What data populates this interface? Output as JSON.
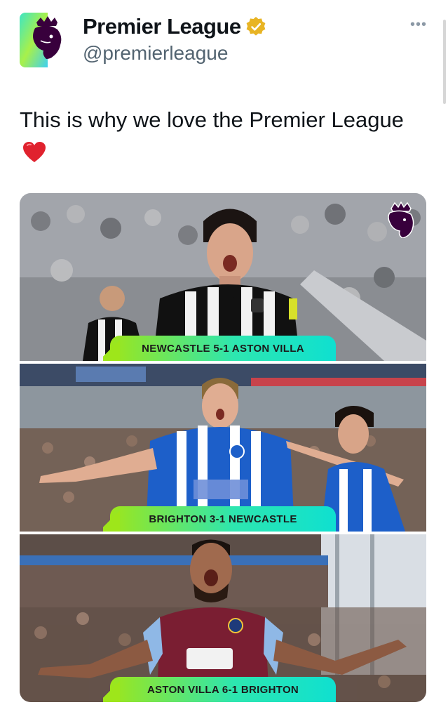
{
  "account": {
    "name": "Premier League",
    "handle": "@premierleague",
    "verified": true,
    "avatar_icon": "premier-league-lion-logo",
    "more_label": "•••"
  },
  "tweet": {
    "text": "This is why we love the Premier League",
    "emoji": "red-heart"
  },
  "media": {
    "panels": [
      {
        "caption": "NEWCASTLE 5-1 ASTON VILLA",
        "kit_colors": [
          "#111111",
          "#f2f2f2"
        ]
      },
      {
        "caption": "BRIGHTON 3-1 NEWCASTLE",
        "kit_colors": [
          "#1d5fc9",
          "#ffffff"
        ]
      },
      {
        "caption": "ASTON VILLA 6-1 BRIGHTON",
        "kit_colors": [
          "#7a1e32",
          "#8fb8e6"
        ]
      }
    ],
    "caption_gradient": [
      "#9ee61a",
      "#0fe0d0"
    ]
  }
}
